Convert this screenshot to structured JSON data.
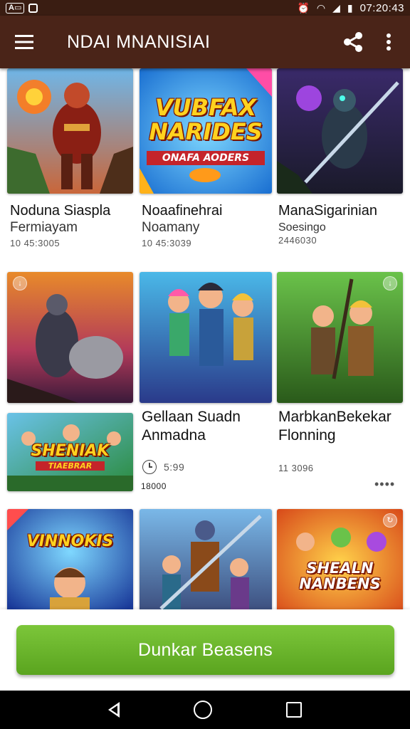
{
  "status_bar": {
    "chip_label": "A",
    "time": "07:20:43"
  },
  "app_bar": {
    "title": "NDAI MNANISIAI"
  },
  "cards": [
    {
      "title": "Noduna Siaspla",
      "subtitle": "Fermiayam",
      "meta": "10 45:3005"
    },
    {
      "title": "Noaafinehrai",
      "subtitle": "Noamany",
      "meta": "10 45:3039"
    },
    {
      "title": "ManaSigarinian",
      "subtitle": "Soesingo",
      "meta": "2446030"
    },
    {
      "title": "Gellaan Suadn",
      "subtitle": "Anmadna",
      "meta": "5:99",
      "meta2": "18000"
    },
    {
      "title": "MarbkanBekekar",
      "subtitle": "Flonning",
      "meta": "11 3096",
      "more": "••••"
    }
  ],
  "art_labels": {
    "top_middle_line1": "VUBFAX",
    "top_middle_line2": "NARIDES",
    "top_middle_banner": "ONAFA AODERS",
    "small_card_line1": "SHENIAK",
    "small_card_line2": "TIAEBRAR",
    "bottom_left": "VINNOKIS",
    "bottom_right_line1": "SHEALN",
    "bottom_right_line2": "NANBENS"
  },
  "cta": {
    "label": "Dunkar Beasens"
  },
  "colors": {
    "status_bar": "#3a1d12",
    "app_bar": "#4a2418",
    "cta": "#6ab52a",
    "nav_bar": "#000000"
  },
  "icons": {
    "menu": "hamburger-icon",
    "share": "share-icon",
    "more": "more-vert-icon",
    "clock": "clock-icon"
  }
}
